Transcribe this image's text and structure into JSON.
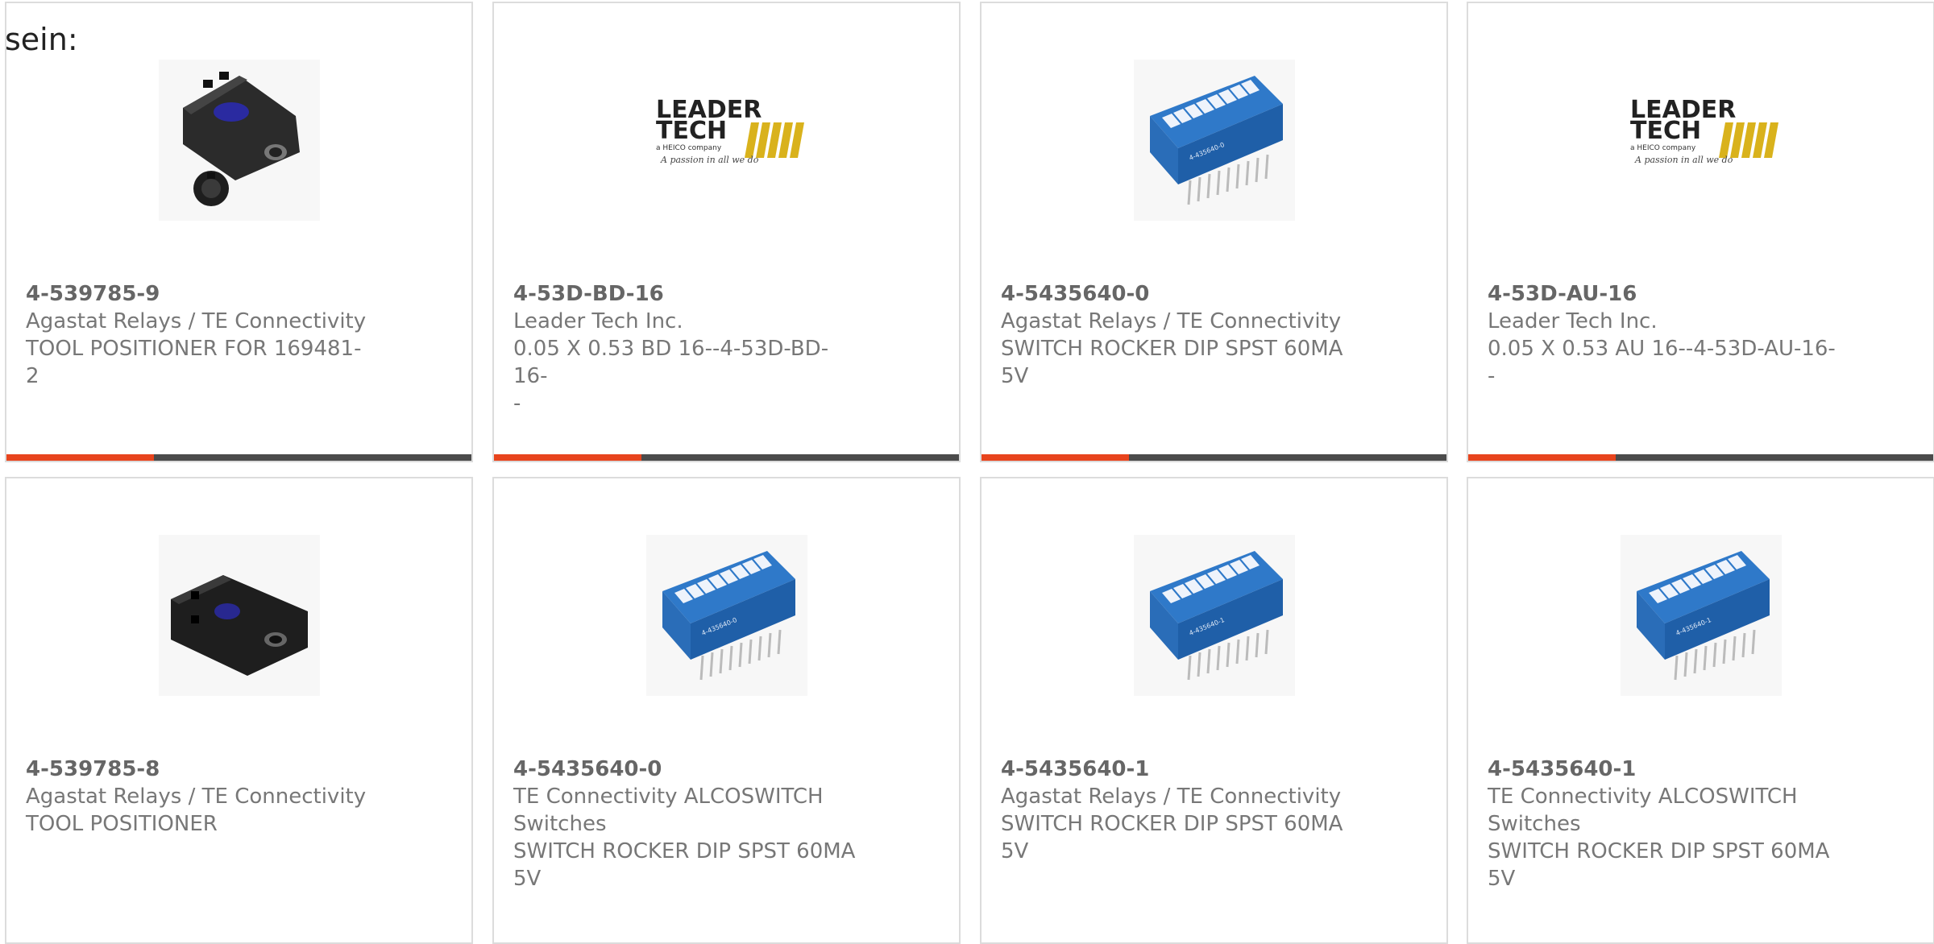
{
  "intro_text": "sein:",
  "colors": {
    "accent": "#e8441d",
    "bar": "#4b4b4b",
    "border": "#dcdcdc",
    "text": "#777777"
  },
  "products": [
    {
      "part": "4-539785-9",
      "lines": [
        "Agastat Relays / TE Connectivity",
        "TOOL POSITIONER FOR 169481-",
        "2"
      ],
      "image": "tool-positioner-screw-image"
    },
    {
      "part": "4-53D-BD-16",
      "lines": [
        "Leader Tech Inc.",
        "0.05 X 0.53 BD 16--4-53D-BD-16-",
        "-"
      ],
      "image": "leader-tech-logo-image",
      "logo": {
        "l1": "LEADER",
        "l2": "TECH",
        "l3": "a HEICO company",
        "l4": "A passion in all we do"
      }
    },
    {
      "part": "4-5435640-0",
      "lines": [
        "Agastat Relays / TE Connectivity",
        "SWITCH ROCKER DIP SPST 60MA",
        "5V"
      ],
      "image": "dip-switch-image",
      "label": "4-435640-0"
    },
    {
      "part": "4-53D-AU-16",
      "lines": [
        "Leader Tech Inc.",
        "0.05 X 0.53 AU 16--4-53D-AU-16-",
        "-"
      ],
      "image": "leader-tech-logo-image",
      "logo": {
        "l1": "LEADER",
        "l2": "TECH",
        "l3": "a HEICO company",
        "l4": "A passion in all we do"
      }
    },
    {
      "part": "4-539785-8",
      "lines": [
        "Agastat Relays / TE Connectivity",
        "TOOL POSITIONER"
      ],
      "image": "tool-positioner-image"
    },
    {
      "part": "4-5435640-0",
      "lines": [
        "TE Connectivity ALCOSWITCH",
        "Switches",
        "SWITCH ROCKER DIP SPST 60MA",
        "5V"
      ],
      "image": "dip-switch-image",
      "label": "4-435640-0"
    },
    {
      "part": "4-5435640-1",
      "lines": [
        "Agastat Relays / TE Connectivity",
        "SWITCH ROCKER DIP SPST 60MA",
        "5V"
      ],
      "image": "dip-switch-image",
      "label": "4-435640-1"
    },
    {
      "part": "4-5435640-1",
      "lines": [
        "TE Connectivity ALCOSWITCH",
        "Switches",
        "SWITCH ROCKER DIP SPST 60MA",
        "5V"
      ],
      "image": "dip-switch-image",
      "label": "4-435640-1"
    }
  ]
}
